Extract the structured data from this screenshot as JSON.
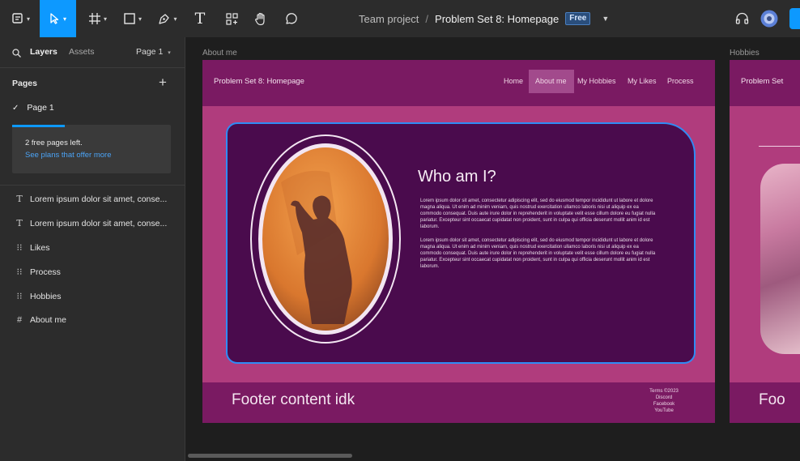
{
  "toolbar": {
    "file_team": "Team project",
    "file_separator": "/",
    "file_name": "Problem Set 8: Homepage",
    "plan_badge": "Free",
    "tools": [
      "main-menu-icon",
      "move-icon",
      "frame-icon",
      "rectangle-icon",
      "pen-icon",
      "text-icon",
      "component-icon",
      "hand-icon",
      "comment-icon"
    ],
    "text_tool_glyph": "T"
  },
  "sidebar": {
    "tabs": [
      "Layers",
      "Assets"
    ],
    "page_selector": "Page 1",
    "pages_heading": "Pages",
    "add_page": "+",
    "pages": [
      {
        "label": "Page 1",
        "selected": true
      }
    ],
    "banner": {
      "title": "2 free pages left.",
      "link": "See plans that offer more"
    },
    "layers": [
      {
        "label": "Lorem ipsum dolor sit amet, conse...",
        "icon": "text-icon"
      },
      {
        "label": "Lorem ipsum dolor sit amet, conse...",
        "icon": "text-icon"
      },
      {
        "label": "Likes",
        "icon": "auto-layout-icon"
      },
      {
        "label": "Process",
        "icon": "auto-layout-icon"
      },
      {
        "label": "Hobbies",
        "icon": "auto-layout-icon"
      },
      {
        "label": "About me",
        "icon": "frame-grid-icon"
      }
    ]
  },
  "canvas": {
    "frame_label": "About me",
    "frame2_label": "Hobbies",
    "site_title": "Problem Set 8: Homepage",
    "nav": [
      "Home",
      "About me",
      "My Hobbies",
      "My Likes",
      "Process"
    ],
    "active_nav": "About me",
    "heading": "Who am I?",
    "paragraph1": "Lorem ipsum dolor sit amet, consectetur adipiscing elit, sed do eiusmod tempor incididunt ut labore et dolore magna aliqua. Ut enim ad minim veniam, quis nostrud exercitation ullamco laboris nisi ut aliquip ex ea commodo consequat. Duis aute irure dolor in reprehenderit in voluptate velit esse cillum dolore eu fugiat nulla pariatur. Excepteur sint occaecat cupidatat non proident, sunt in culpa qui officia deserunt mollit anim id est laborum.",
    "paragraph2": "Lorem ipsum dolor sit amet, consectetur adipiscing elit, sed do eiusmod tempor incididunt ut labore et dolore magna aliqua. Ut enim ad minim veniam, quis nostrud exercitation ullamco laboris nisi ut aliquip ex ea commodo consequat. Duis aute irure dolor in reprehenderit in voluptate velit esse cillum dolore eu fugiat nulla pariatur. Excepteur sint occaecat cupidatat non proident, sunt in culpa qui officia deserunt mollit anim id est laborum.",
    "footer_text": "Footer content idk",
    "footer_links": [
      "Terms ©2023",
      "Discord",
      "Facebook",
      "YouTube"
    ],
    "frame2_site_title": "Problem Set",
    "frame2_footer_text": "Foo"
  },
  "colors": {
    "accent": "#0d99ff",
    "frame_header": "#7a1a62",
    "frame_body": "#b03c7d",
    "card": "#4a0b4d",
    "card_border": "#2f8cf5",
    "portrait": "#e58a3b"
  }
}
